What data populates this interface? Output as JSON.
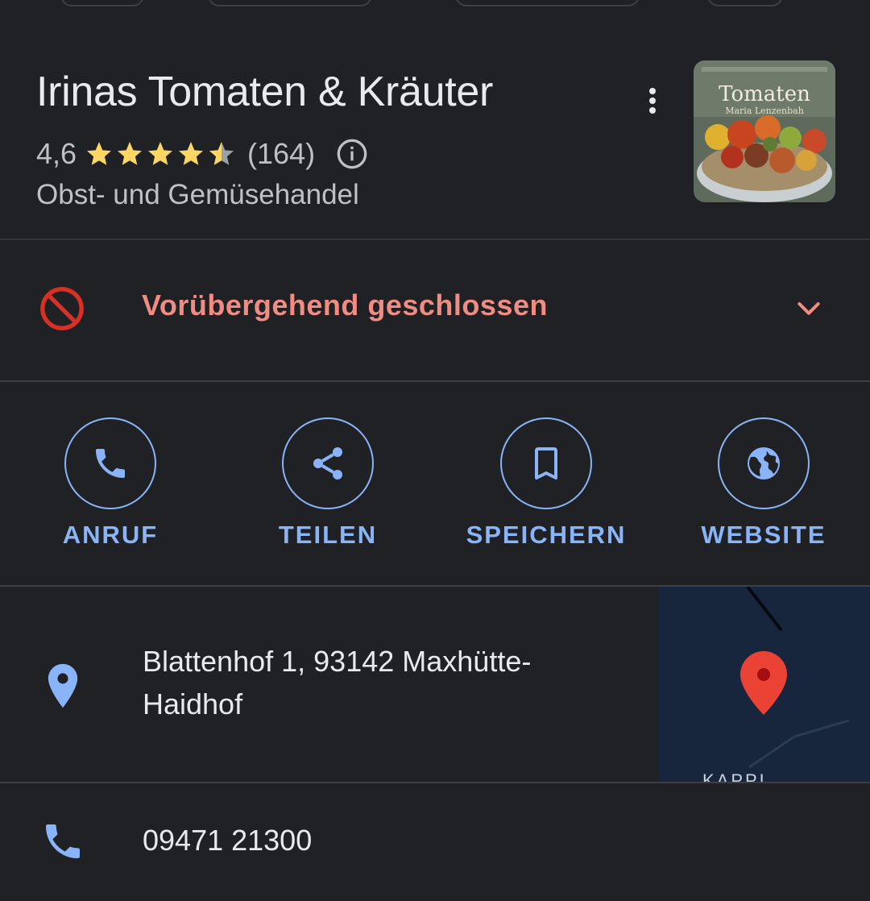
{
  "place": {
    "name": "Irinas Tomaten & Kräuter",
    "rating": "4,6",
    "stars": 4.6,
    "review_count": "(164)",
    "category": "Obst- und Gemüsehandel",
    "thumbnail": {
      "title": "Tomaten",
      "author": "Maria Lenzenbah"
    }
  },
  "status": {
    "text": "Vorübergehend geschlossen",
    "color": "#f28b82"
  },
  "actions": [
    {
      "label": "ANRUF",
      "icon": "phone-icon"
    },
    {
      "label": "TEILEN",
      "icon": "share-icon"
    },
    {
      "label": "SPEICHERN",
      "icon": "bookmark-icon"
    },
    {
      "label": "WEBSITE",
      "icon": "globe-icon"
    }
  ],
  "address": {
    "line1": "Blattenhof 1, 93142 Maxhütte-",
    "line2": "Haidhof",
    "map_label": "KAPPL"
  },
  "phone": {
    "number": "09471 21300"
  },
  "colors": {
    "accent": "#8ab4f8",
    "star": "#fdd663",
    "background": "#202124",
    "map_pin": "#ea4335"
  }
}
